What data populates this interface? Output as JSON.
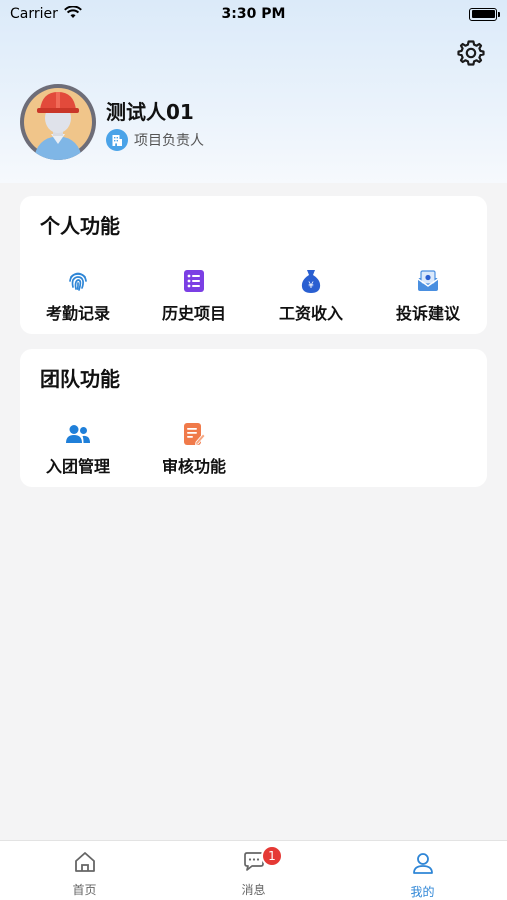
{
  "status_bar": {
    "carrier": "Carrier",
    "time": "3:30 PM"
  },
  "profile": {
    "name": "测试人01",
    "role": "项目负责人"
  },
  "personal_section": {
    "title": "个人功能",
    "items": [
      {
        "label": "考勤记录",
        "icon": "fingerprint-icon",
        "color": "#2f86d6"
      },
      {
        "label": "历史项目",
        "icon": "list-icon",
        "color": "#7b3fe4"
      },
      {
        "label": "工资收入",
        "icon": "money-bag-icon",
        "color": "#2a5fd1"
      },
      {
        "label": "投诉建议",
        "icon": "mail-icon",
        "color": "#4a8fe0"
      }
    ]
  },
  "team_section": {
    "title": "团队功能",
    "items": [
      {
        "label": "入团管理",
        "icon": "team-icon",
        "color": "#1f7fd9"
      },
      {
        "label": "审核功能",
        "icon": "audit-icon",
        "color": "#f07a4a"
      }
    ]
  },
  "tabbar": {
    "tabs": [
      {
        "label": "首页",
        "icon": "home-icon"
      },
      {
        "label": "消息",
        "icon": "chat-icon",
        "badge": "1"
      },
      {
        "label": "我的",
        "icon": "user-icon",
        "active": true
      }
    ]
  },
  "colors": {
    "accent": "#2f86d6",
    "badge": "#e53935"
  }
}
